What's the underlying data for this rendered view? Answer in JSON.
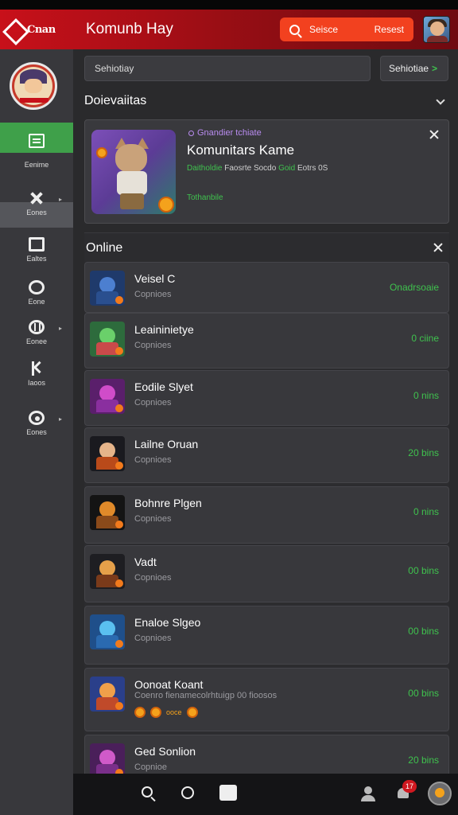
{
  "header": {
    "logo_text": "Cnan",
    "title": "Komunb Hay",
    "search_left": "Seisce",
    "search_right": "Resest"
  },
  "sidebar": {
    "items": [
      {
        "label": "Eenime",
        "icon": "chat-icon"
      },
      {
        "label": "Eones",
        "icon": "crossed-swords-icon"
      },
      {
        "label": "Ealtes",
        "icon": "monitor-icon"
      },
      {
        "label": "Eone",
        "icon": "chat-bubble-icon"
      },
      {
        "label": "Eonee",
        "icon": "globe-icon"
      },
      {
        "label": "Iaoos",
        "icon": "k-icon"
      },
      {
        "label": "Eones",
        "icon": "steam-icon"
      }
    ]
  },
  "filter": {
    "input_value": "Sehiotiay",
    "button_label": "Sehiotiae"
  },
  "section": {
    "title": "Doievaiitas"
  },
  "feature": {
    "tag": "Gnandier tchiate",
    "name": "Komunitars Kame",
    "desc_green1": "Daitholdie",
    "desc_mid": " Faosrte Socdo ",
    "desc_green2": "Goid",
    "desc_tail": " Eotrs 0S",
    "status": "Tothanbile"
  },
  "online": {
    "title": "Online",
    "rows": [
      {
        "name": "Veisel C",
        "sub": "Copnioes",
        "status": "Onadrsoaie",
        "thumb_bg": "#1f3a6b",
        "thumb_a": "#4c7fd0",
        "thumb_b": "#2a4f8f"
      },
      {
        "name": "Leaininietye",
        "sub": "Copnioes",
        "status": "0 ciine",
        "thumb_bg": "#2d6b3c",
        "thumb_a": "#6ad06a",
        "thumb_b": "#c94a4a"
      },
      {
        "name": "Eodile Slyet",
        "sub": "Copnioes",
        "status": "0 nins",
        "thumb_bg": "#5a1f6b",
        "thumb_a": "#d04cc9",
        "thumb_b": "#8a2f9f"
      },
      {
        "name": "Lailne Oruan",
        "sub": "Copnioes",
        "status": "20 bins",
        "thumb_bg": "#1a1a1f",
        "thumb_a": "#e5b48a",
        "thumb_b": "#b94a1a"
      },
      {
        "name": "Bohnre Plgen",
        "sub": "Copnioes",
        "status": "0 nins",
        "thumb_bg": "#141414",
        "thumb_a": "#e08a2a",
        "thumb_b": "#8a4a1a"
      },
      {
        "name": "Vadt",
        "sub": "Copnioes",
        "status": "00 bins",
        "thumb_bg": "#1e1e22",
        "thumb_a": "#e5a04a",
        "thumb_b": "#7a3a1a"
      },
      {
        "name": "Enaloe Slgeo",
        "sub": "Copnioes",
        "status": "00 bins",
        "thumb_bg": "#1f4f8a",
        "thumb_a": "#5ac0f0",
        "thumb_b": "#2a6ab0"
      },
      {
        "name": "Oonoat Koant",
        "sub": "Coenro fienamecolrhtuigp 00 fioosos",
        "status": "00 bins",
        "thumb_bg": "#2a3f8a",
        "thumb_a": "#f0a04a",
        "thumb_b": "#c04a2a",
        "coins_text": "ooce"
      },
      {
        "name": "Ged Sonlion",
        "sub": "Copnioe",
        "status": "20 bins",
        "thumb_bg": "#4a1f5a",
        "thumb_a": "#d05ac9",
        "thumb_b": "#7a2f8a"
      }
    ]
  },
  "bottombar": {
    "badge": "17"
  },
  "colors": {
    "brand_red": "#c8101a",
    "accent_orange": "#f2411f",
    "online_green": "#3fc24e"
  }
}
